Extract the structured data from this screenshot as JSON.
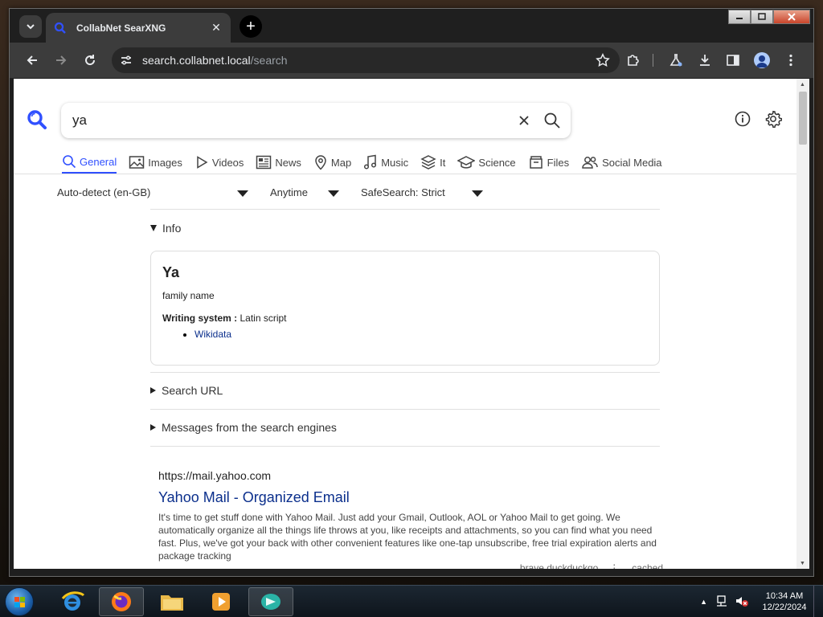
{
  "browser": {
    "tab_title": "CollabNet SearXNG",
    "tab_close": "✕",
    "new_tab": "+",
    "url_host": "search.collabnet.local",
    "url_path": "/search"
  },
  "search": {
    "query": "ya",
    "categories": [
      {
        "label": "General",
        "active": true,
        "icon": "search-icon"
      },
      {
        "label": "Images",
        "active": false,
        "icon": "image-icon"
      },
      {
        "label": "Videos",
        "active": false,
        "icon": "play-icon"
      },
      {
        "label": "News",
        "active": false,
        "icon": "newspaper-icon"
      },
      {
        "label": "Map",
        "active": false,
        "icon": "map-pin-icon"
      },
      {
        "label": "Music",
        "active": false,
        "icon": "music-note-icon"
      },
      {
        "label": "It",
        "active": false,
        "icon": "layers-icon"
      },
      {
        "label": "Science",
        "active": false,
        "icon": "graduation-cap-icon"
      },
      {
        "label": "Files",
        "active": false,
        "icon": "file-box-icon"
      },
      {
        "label": "Social Media",
        "active": false,
        "icon": "people-icon"
      }
    ],
    "filters": {
      "language": "Auto-detect (en-GB)",
      "time_range": "Anytime",
      "safesearch": "SafeSearch: Strict"
    }
  },
  "infobox": {
    "summary": "Info",
    "title": "Ya",
    "subtitle": "family name",
    "attr_label": "Writing system :",
    "attr_value": " Latin script",
    "link": "Wikidata"
  },
  "collapsibles": {
    "search_url": "Search URL",
    "engine_messages": "Messages from the search engines"
  },
  "results": [
    {
      "url": "https://mail.yahoo.com",
      "title": "Yahoo Mail - Organized Email",
      "content": "It's time to get stuff done with Yahoo Mail. Just add your Gmail, Outlook, AOL or Yahoo Mail to get going. We automatically organize all the things life throws at you, like receipts and attachments, so you can find what you need fast. Plus, we've got your back with other convenient features like one-tap unsubscribe, free trial expiration alerts and package tracking",
      "engines": "brave  duckduckgo",
      "dots": "⋮",
      "cached": "cached"
    }
  ],
  "taskbar": {
    "time": "10:34 AM",
    "date": "12/22/2024"
  },
  "colors": {
    "accent": "#3050ff",
    "link": "#0b2f8c"
  }
}
